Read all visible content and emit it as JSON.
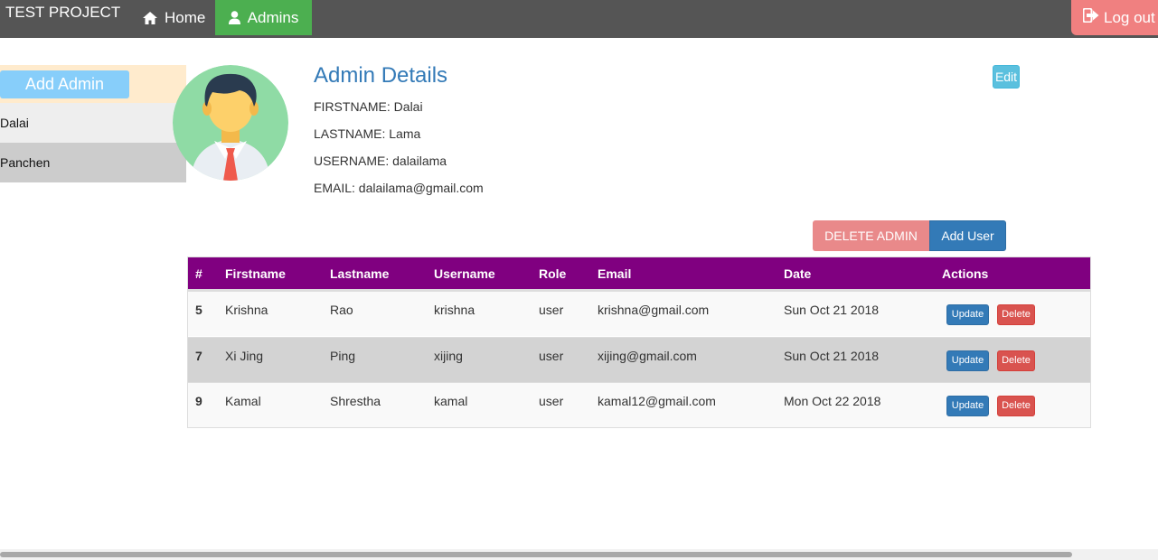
{
  "navbar": {
    "brand": "TEST PROJECT",
    "items": [
      {
        "label": "Home",
        "icon": "home-icon"
      },
      {
        "label": "Admins",
        "icon": "user-icon",
        "active": true
      }
    ],
    "logout_label": "Log out",
    "logout_icon": "logout-icon",
    "colors": {
      "bar": "#555555",
      "active": "#4caf50",
      "logout": "#f08080"
    }
  },
  "sidebar": {
    "add_admin_label": "Add Admin",
    "admins": [
      {
        "name": "Dalai"
      },
      {
        "name": "Panchen"
      }
    ]
  },
  "details": {
    "title": "Admin Details",
    "edit_label": "Edit",
    "fields": [
      {
        "text": "FIRSTNAME: Dalai"
      },
      {
        "text": "LASTNAME: Lama"
      },
      {
        "text": "USERNAME: dalailama"
      },
      {
        "text": "EMAIL: dalailama@gmail.com"
      }
    ],
    "delete_admin_label": "DELETE ADMIN",
    "add_user_label": "Add User"
  },
  "table": {
    "headers": [
      "#",
      "Firstname",
      "Lastname",
      "Username",
      "Role",
      "Email",
      "Date",
      "Actions"
    ],
    "rows": [
      {
        "id": "5",
        "firstname": "Krishna",
        "lastname": "Rao",
        "username": "krishna",
        "role": "user",
        "email": "krishna@gmail.com",
        "date": "Sun Oct 21 2018"
      },
      {
        "id": "7",
        "firstname": "Xi Jing",
        "lastname": "Ping",
        "username": "xijing",
        "role": "user",
        "email": "xijing@gmail.com",
        "date": "Sun Oct 21 2018"
      },
      {
        "id": "9",
        "firstname": "Kamal",
        "lastname": "Shrestha",
        "username": "kamal",
        "role": "user",
        "email": "kamal12@gmail.com",
        "date": "Mon Oct 22 2018"
      }
    ],
    "update_label": "Update",
    "delete_label": "Delete",
    "header_color": "#800080"
  }
}
